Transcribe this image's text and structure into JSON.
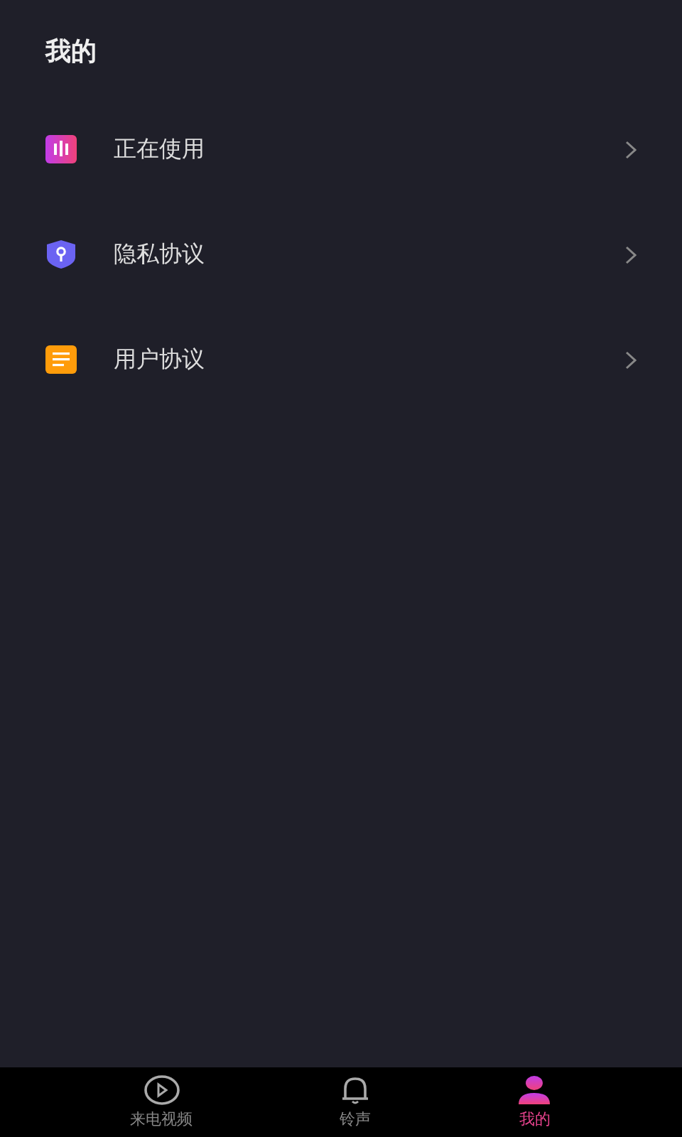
{
  "header": {
    "title": "我的"
  },
  "menu": [
    {
      "label": "正在使用",
      "kind": "playing"
    },
    {
      "label": "隐私协议",
      "kind": "privacy"
    },
    {
      "label": "用户协议",
      "kind": "terms"
    }
  ],
  "tab_bar": [
    {
      "label": "来电视频",
      "kind": "video",
      "selected": false
    },
    {
      "label": "铃声",
      "kind": "bell",
      "selected": false
    },
    {
      "label": "我的",
      "kind": "person",
      "selected": true
    }
  ]
}
